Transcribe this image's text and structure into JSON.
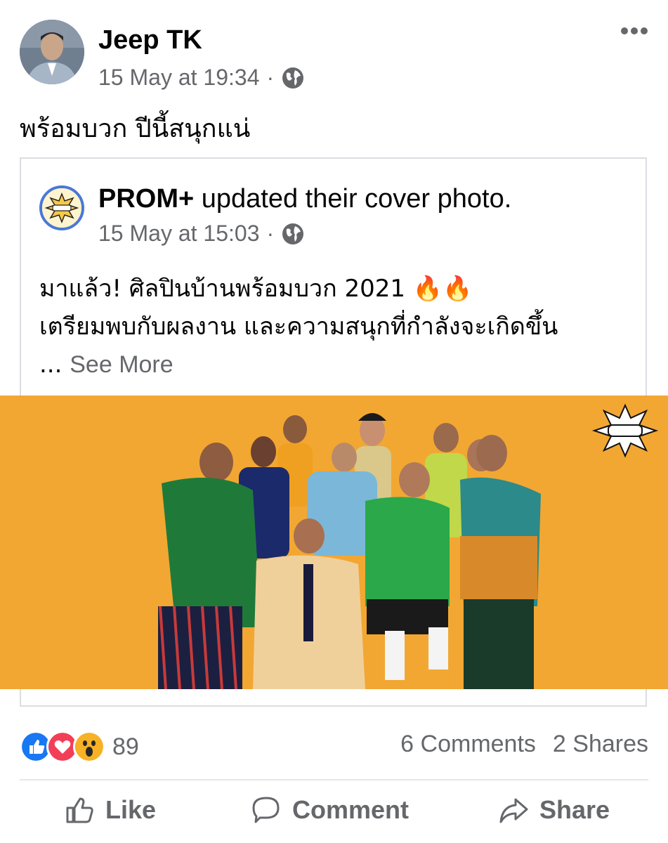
{
  "post": {
    "author": "Jeep TK",
    "timestamp": "15 May at 19:34",
    "separator": "·",
    "text": "พร้อมบวก ปีนี้สนุกแน่"
  },
  "shared": {
    "page_name": "PROM+",
    "action_text": " updated their cover photo.",
    "timestamp": "15 May at 15:03",
    "separator": "·",
    "line1": "มาแล้ว! ศิลปินบ้านพร้อมบวก 2021 🔥🔥",
    "line2": "เตรียมพบกับผลงาน และความสนุกที่กำลังจะเกิดขึ้น",
    "ellipsis": "...",
    "see_more": "See More",
    "logo_text": "PROM+"
  },
  "stats": {
    "reaction_count": "89",
    "comments": "6 Comments",
    "shares": "2 Shares"
  },
  "actions": {
    "like": "Like",
    "comment": "Comment",
    "share": "Share"
  },
  "icons": {
    "globe": "globe-icon",
    "more": "more-icon",
    "like_reaction": "like-reaction-icon",
    "love_reaction": "love-reaction-icon",
    "wow_reaction": "wow-reaction-icon"
  },
  "colors": {
    "cover_background": "#f2a733",
    "like_blue": "#1877f2",
    "love_red": "#f33e58",
    "wow_yellow": "#f7b125",
    "secondary_text": "#65676b"
  }
}
